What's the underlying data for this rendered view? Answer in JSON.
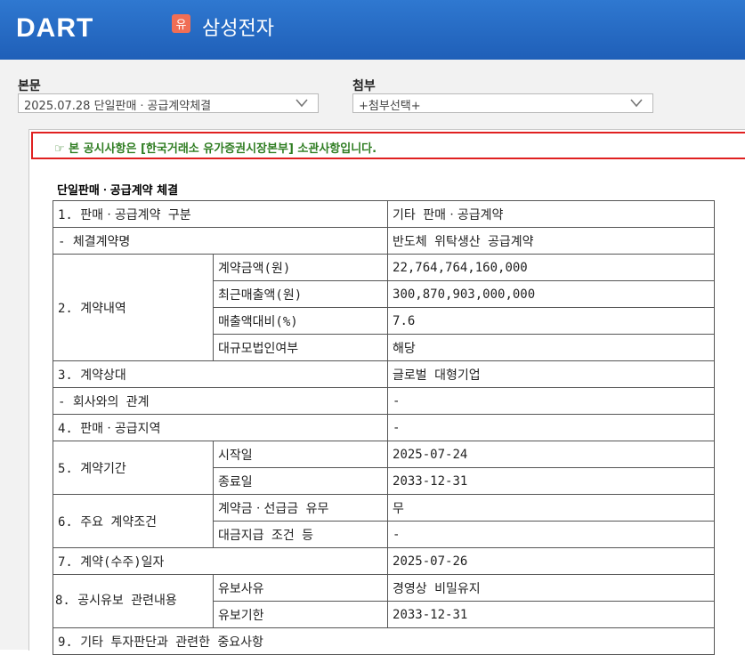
{
  "header": {
    "logo": "DART",
    "market_badge": "유",
    "company": "삼성전자"
  },
  "selectors": {
    "main_label": "본문",
    "main_value": "2025.07.28  단일판매ㆍ공급계약체결",
    "attach_label": "첨부",
    "attach_value": "+첨부선택+"
  },
  "notice": "☞ 본 공시사항은 [한국거래소 유가증권시장본부] 소관사항입니다.",
  "doc_title": "단일판매ㆍ공급계약 체결",
  "rows": {
    "r1": {
      "label": "1. 판매ㆍ공급계약 구분",
      "value": "기타 판매ㆍ공급계약"
    },
    "r1b": {
      "label": "- 체결계약명",
      "value": "반도체 위탁생산 공급계약"
    },
    "r2": {
      "label": "2. 계약내역",
      "items": [
        {
          "sub": "계약금액(원)",
          "value": "22,764,764,160,000"
        },
        {
          "sub": "최근매출액(원)",
          "value": "300,870,903,000,000"
        },
        {
          "sub": "매출액대비(%)",
          "value": "7.6"
        },
        {
          "sub": "대규모법인여부",
          "value": "해당"
        }
      ]
    },
    "r3": {
      "label": "3. 계약상대",
      "value": "글로벌 대형기업"
    },
    "r3b": {
      "label": "- 회사와의 관계",
      "value": "-"
    },
    "r4": {
      "label": "4. 판매ㆍ공급지역",
      "value": "-"
    },
    "r5": {
      "label": "5. 계약기간",
      "items": [
        {
          "sub": "시작일",
          "value": "2025-07-24"
        },
        {
          "sub": "종료일",
          "value": "2033-12-31"
        }
      ]
    },
    "r6": {
      "label": "6. 주요 계약조건",
      "items": [
        {
          "sub": "계약금ㆍ선급금 유무",
          "value": "무"
        },
        {
          "sub": "대금지급 조건 등",
          "value": "-"
        }
      ]
    },
    "r7": {
      "label": "7. 계약(수주)일자",
      "value": "2025-07-26"
    },
    "r8": {
      "label": "8. 공시유보 관련내용",
      "items": [
        {
          "sub": "유보사유",
          "value": "경영상 비밀유지"
        },
        {
          "sub": "유보기한",
          "value": "2033-12-31"
        }
      ]
    },
    "r9": {
      "label": "9. 기타 투자판단과 관련한 중요사항"
    }
  }
}
